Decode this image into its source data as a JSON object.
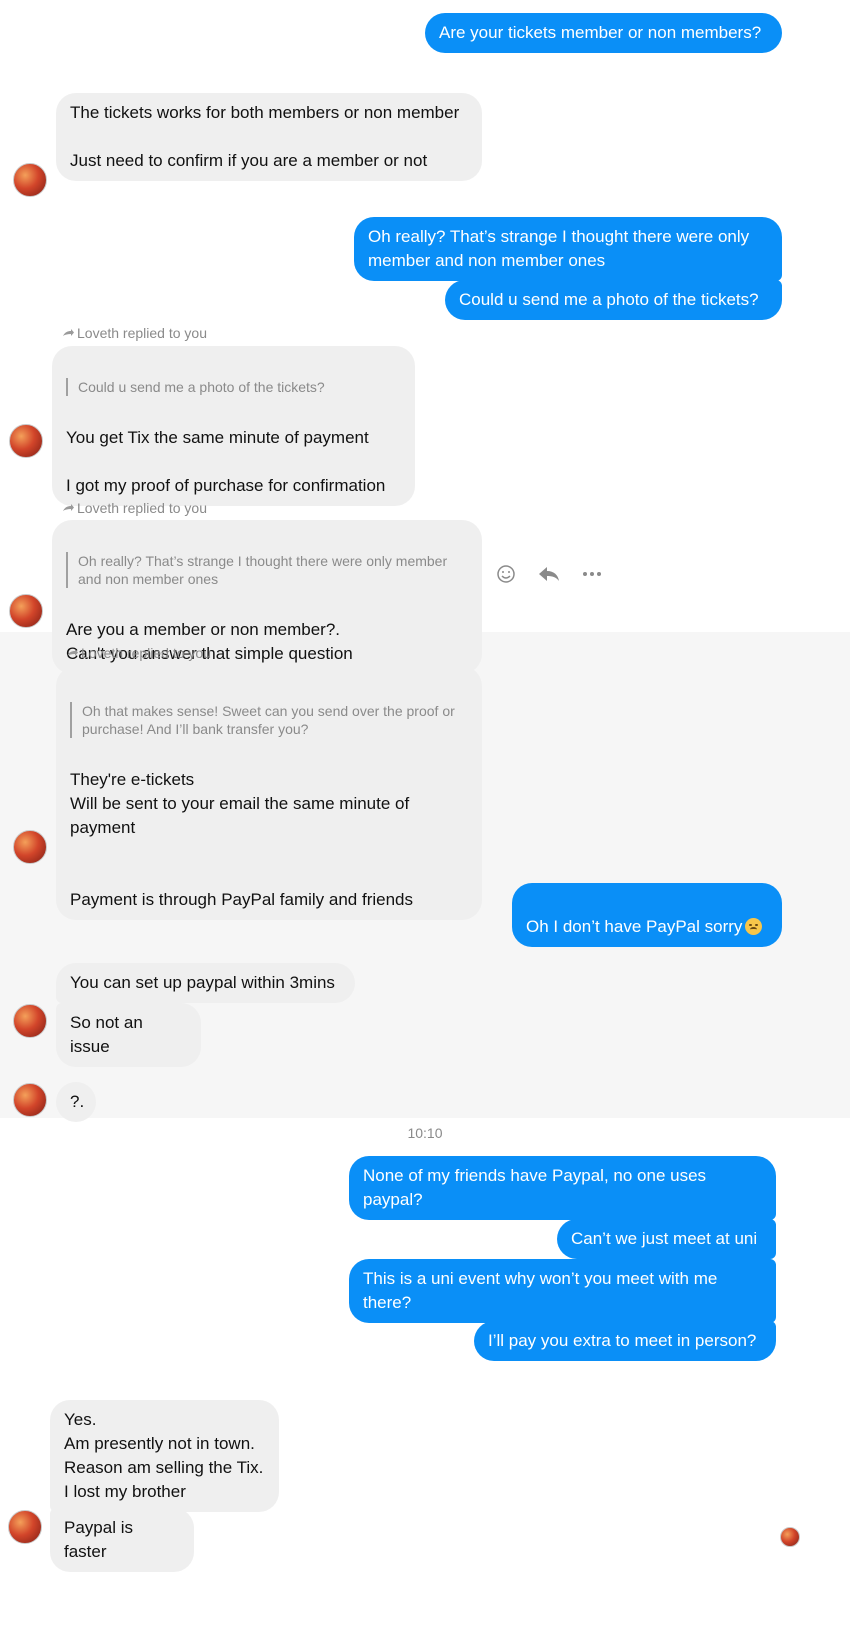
{
  "messages": {
    "m1": "Are your tickets member or non members?",
    "m2": "The tickets works for both members or non member\n\nJust need to confirm if you are a member or not",
    "m3": "Oh really? That’s strange I thought there were only member and non member ones",
    "m4": "Could u send me a photo of the tickets?",
    "m5_quote": "Could u send me a photo of the tickets?",
    "m5": "You get Tix the same minute of payment\n\nI got my proof of purchase for confirmation",
    "m6_quote": "Oh really? That’s strange I thought there were only member and non member ones",
    "m6": "Are you a member or non member?.\nCan't you answer that simple question",
    "m7_quote": "Oh that makes sense! Sweet can you send over the proof or purchase! And I’ll bank transfer you?",
    "m7": "They're e-tickets\nWill be sent to your email the same minute of payment\n\n\nPayment is through PayPal family and friends",
    "m8": "Oh I don’t have PayPal sorry",
    "m9": "You can set up paypal within 3mins",
    "m10": "So not an issue",
    "m11": "?.",
    "m12": "None of my friends have Paypal, no one uses paypal?",
    "m13": "Can’t we just meet at uni",
    "m14": "This is a uni event why won’t you meet with me there?",
    "m15": "I’ll pay you extra to meet in person?",
    "m16": "Yes.\nAm presently not in town.\nReason am selling the Tix.\nI lost my brother",
    "m17": "Paypal is faster"
  },
  "reply_label": "Loveth replied to you",
  "timestamp": "10:10",
  "icons": [
    "reply-arrow-icon",
    "smiley-icon",
    "reply-icon",
    "more-icon",
    "disappointed-emoji-icon",
    "contact-avatar"
  ],
  "colors": {
    "outgoing": "#0a8ff7",
    "incoming": "#efefef",
    "meta": "#8a8a8a"
  }
}
